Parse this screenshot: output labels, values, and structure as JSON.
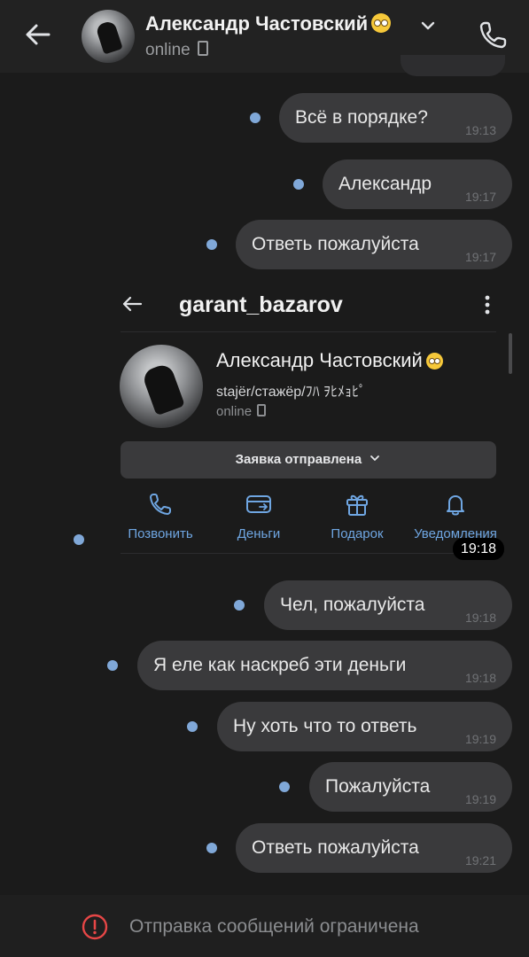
{
  "header": {
    "contact_name": "Александр Частовский",
    "status": "online"
  },
  "messages": [
    {
      "text": "Всё в порядке?",
      "time": "19:13"
    },
    {
      "text": "Александр",
      "time": "19:17"
    },
    {
      "text": "Ответь пожалуйста",
      "time": "19:17"
    },
    {
      "text": "Чел, пожалуйста",
      "time": "19:18"
    },
    {
      "text": "Я еле как наскреб эти деньги",
      "time": "19:18"
    },
    {
      "text": "Ну хоть что то ответь",
      "time": "19:19"
    },
    {
      "text": "Пожалуйста",
      "time": "19:19"
    },
    {
      "text": "Ответь пожалуйста",
      "time": "19:21"
    }
  ],
  "screenshot": {
    "username": "garant_bazarov",
    "name": "Александр Частовский",
    "bio": "stajër/стажёр/ﾌﾊ ｦﾋﾒｮﾋﾟ",
    "status": "online",
    "request_label": "Заявка отправлена",
    "actions": [
      "Позвонить",
      "Деньги",
      "Подарок",
      "Уведомления"
    ],
    "time": "19:18"
  },
  "footer": {
    "restriction_text": "Отправка сообщений ограничена"
  },
  "colors": {
    "background": "#1b1b1b",
    "bubble": "#3a3a3c",
    "accent": "#6fa6e2",
    "unread_dot": "#80a8d8",
    "warning": "#e64646"
  }
}
